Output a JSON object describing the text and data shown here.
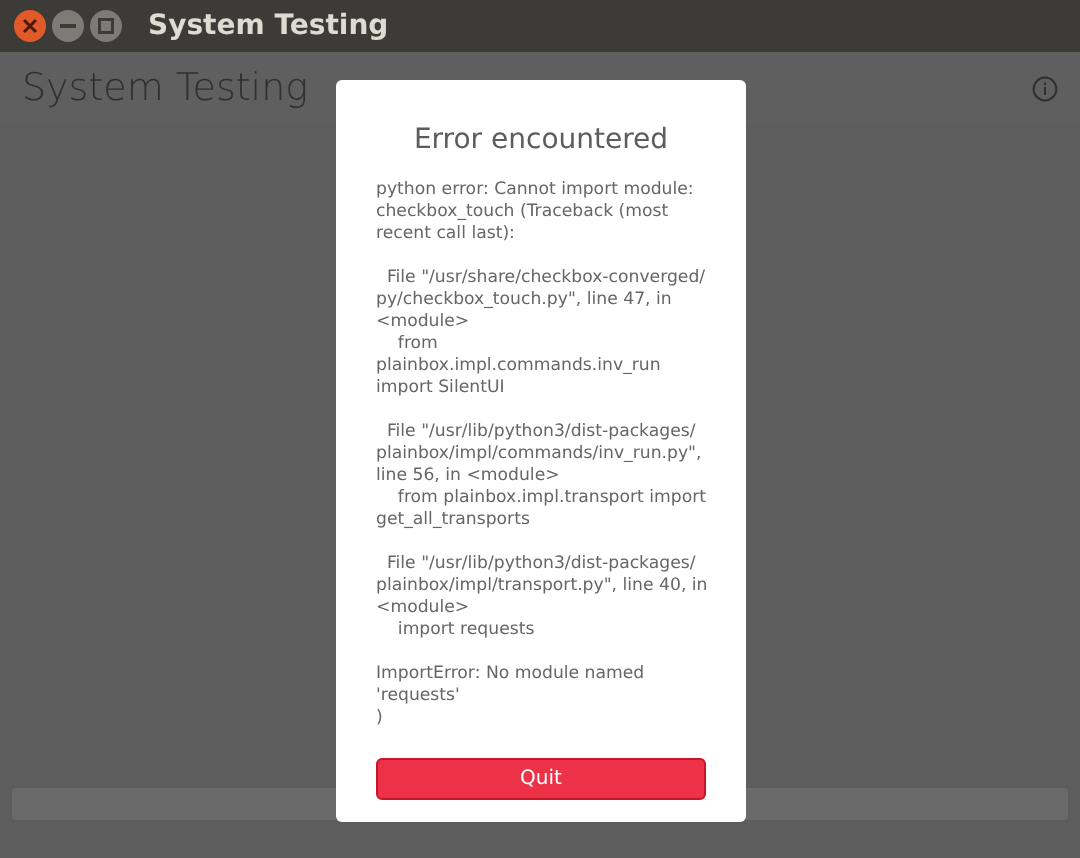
{
  "window": {
    "title": "System Testing"
  },
  "app_header": {
    "title": "System Testing"
  },
  "dialog": {
    "title": "Error encountered",
    "paragraphs": [
      [
        "python error: Cannot import module:",
        "checkbox_touch (Traceback (most",
        "recent call last):"
      ],
      [
        "  File \"/usr/share/checkbox-converged/",
        "py/checkbox_touch.py\", line 47, in",
        "<module>",
        "    from",
        "plainbox.impl.commands.inv_run",
        "import SilentUI"
      ],
      [
        "  File \"/usr/lib/python3/dist-packages/",
        "plainbox/impl/commands/inv_run.py\",",
        "line 56, in <module>",
        "    from plainbox.impl.transport import",
        "get_all_transports"
      ],
      [
        "  File \"/usr/lib/python3/dist-packages/",
        "plainbox/impl/transport.py\", line 40, in",
        "<module>",
        "    import requests"
      ],
      [
        "ImportError: No module named",
        "'requests'",
        ")"
      ]
    ],
    "button": "Quit"
  }
}
